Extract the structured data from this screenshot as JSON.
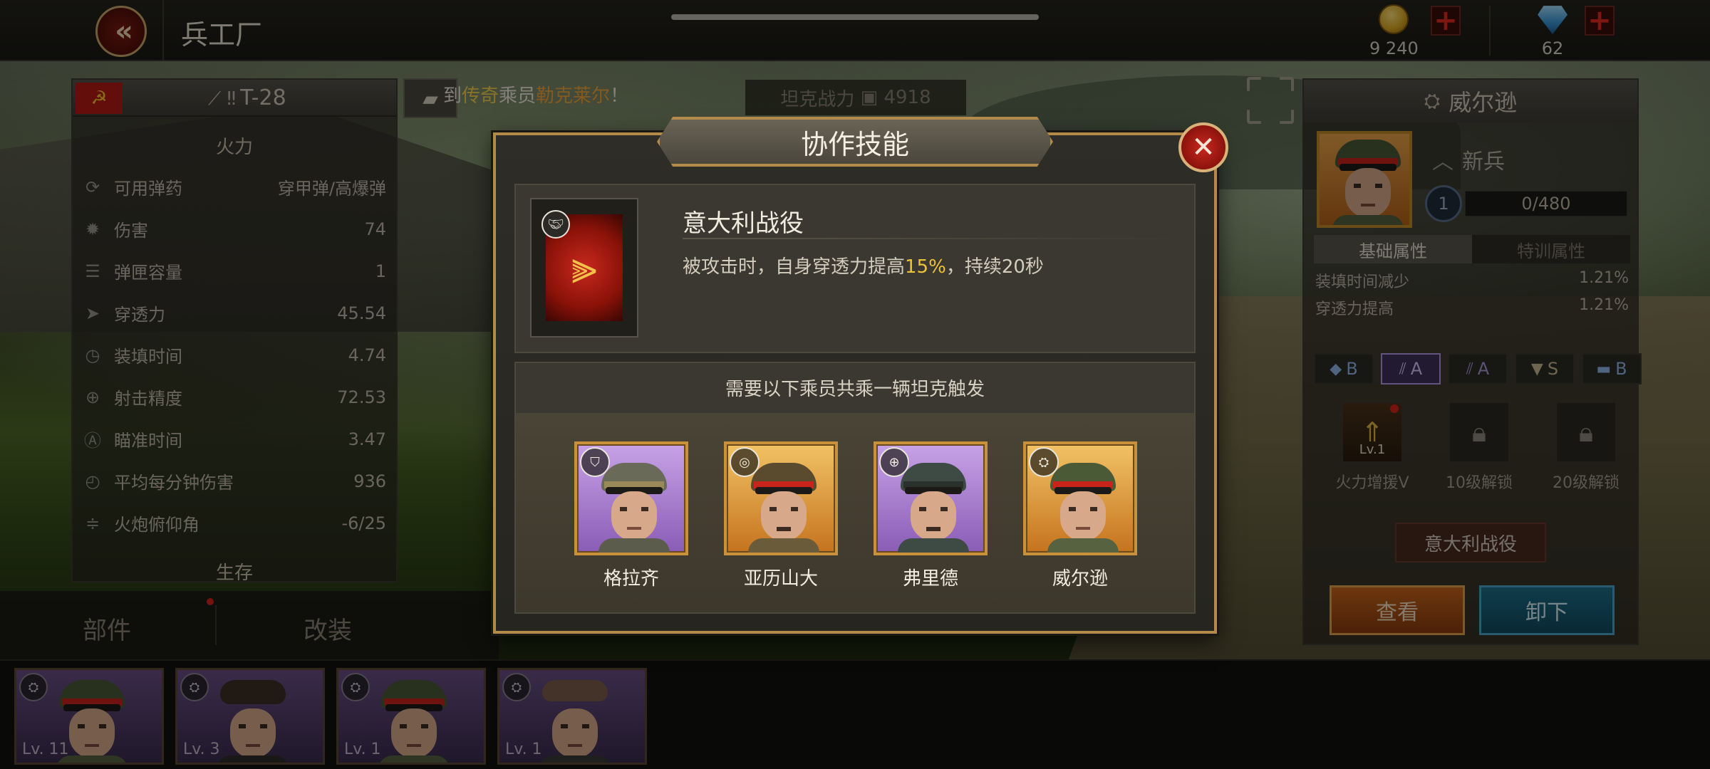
{
  "topbar": {
    "title": "兵工厂",
    "coins": "9 240",
    "gems": "62"
  },
  "left_panel": {
    "tank_name": "T-28",
    "section_firepower": "火力",
    "section_survival": "生存",
    "stats": [
      {
        "icon": "ammo-icon",
        "label": "可用弹药",
        "value": "穿甲弹/高爆弹"
      },
      {
        "icon": "damage-icon",
        "label": "伤害",
        "value": "74"
      },
      {
        "icon": "magazine-icon",
        "label": "弹匣容量",
        "value": "1"
      },
      {
        "icon": "penetration-icon",
        "label": "穿透力",
        "value": "45.54"
      },
      {
        "icon": "reload-icon",
        "label": "装填时间",
        "value": "4.74"
      },
      {
        "icon": "accuracy-icon",
        "label": "射击精度",
        "value": "72.53"
      },
      {
        "icon": "aim-time-icon",
        "label": "瞄准时间",
        "value": "3.47"
      },
      {
        "icon": "dpm-icon",
        "label": "平均每分钟伤害",
        "value": "936"
      },
      {
        "icon": "elevation-icon",
        "label": "火炮俯仰角",
        "value": "-6/25"
      }
    ]
  },
  "notification": {
    "prefix": "到",
    "highlight1": "传奇",
    "middle": "乘员",
    "highlight2": "勒克莱尔",
    "suffix": "！"
  },
  "tank_power_label": "坦克战力",
  "tank_power_value": "4918",
  "bottom_tabs": {
    "parts": "部件",
    "modify": "改装"
  },
  "crew_cards": [
    {
      "level": "Lv. 11",
      "uniform": "purple"
    },
    {
      "level": "Lv. 3",
      "uniform": "purple"
    },
    {
      "level": "Lv. 1",
      "uniform": "purple"
    },
    {
      "level": "Lv. 1",
      "uniform": "purple"
    }
  ],
  "right_panel": {
    "name": "威尔逊",
    "rank": "新兵",
    "level": "1",
    "xp": "0/480",
    "tab_basic": "基础属性",
    "tab_special": "特训属性",
    "attributes": [
      {
        "label": "装填时间减少",
        "value": "1.21%"
      },
      {
        "label": "穿透力提高",
        "value": "1.21%"
      }
    ],
    "grades": [
      "B",
      "A",
      "A",
      "S",
      "B"
    ],
    "skills": [
      {
        "name": "火力增援V",
        "level": "Lv.1"
      },
      {
        "name": "10级解锁"
      },
      {
        "name": "20级解锁"
      }
    ],
    "coop_skill": "意大利战役",
    "view_button": "查看",
    "unload_button": "卸下"
  },
  "modal": {
    "title": "协作技能",
    "skill_name": "意大利战役",
    "skill_desc_pre": "被攻击时，自身穿透力提高",
    "skill_desc_pct": "15%",
    "skill_desc_post": "，持续20秒",
    "requirement": "需要以下乘员共乘一辆坦克触发",
    "members": [
      {
        "name": "格拉齐",
        "frame": "purple"
      },
      {
        "name": "亚历山大",
        "frame": "orange"
      },
      {
        "name": "弗里德",
        "frame": "purple"
      },
      {
        "name": "威尔逊",
        "frame": "orange"
      }
    ]
  },
  "colors": {
    "gold_border": "#b48a4a",
    "highlight_yellow": "#f0c23a",
    "close_red": "#c8281e"
  }
}
